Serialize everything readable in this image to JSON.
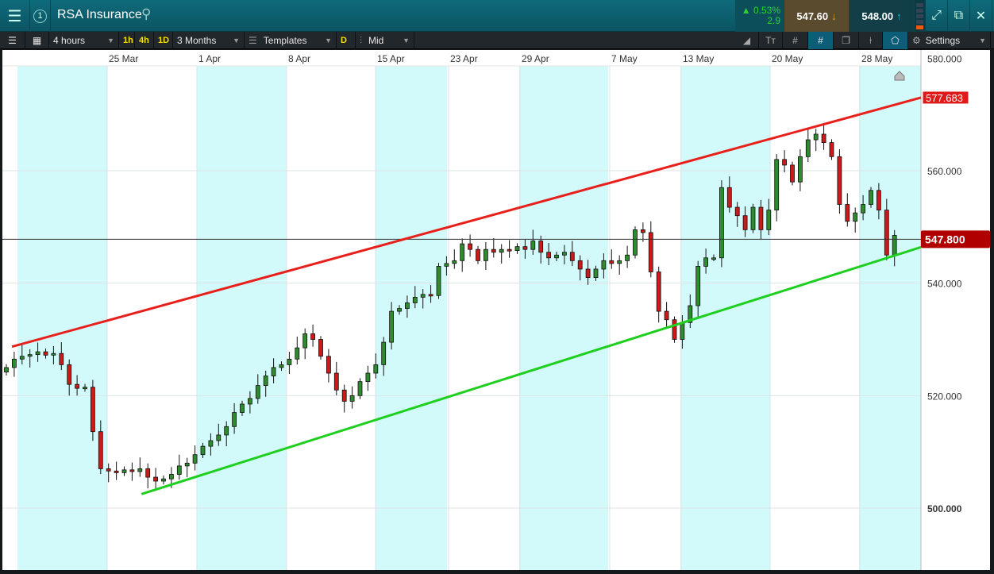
{
  "header": {
    "instrument": "RSA Insurance",
    "badge": "1",
    "change_pct": "0.53%",
    "change_abs": "2.9",
    "sell_price": "547.60",
    "buy_price": "548.00"
  },
  "toolbar": {
    "interval": "4 hours",
    "quick_intervals": [
      "1h",
      "4h",
      "1D"
    ],
    "range": "3 Months",
    "templates": "Templates",
    "d_label": "D",
    "price_type": "Mid",
    "settings": "Settings"
  },
  "colors": {
    "up": "#2e8b2e",
    "down": "#cc1a1a",
    "band": "#d3fafa",
    "resistance": "#e8201c",
    "support": "#1fcf1f",
    "price_tag": "#b00000"
  },
  "chart_data": {
    "type": "candlestick",
    "x_labels": [
      "25 Mar",
      "1 Apr",
      "8 Apr",
      "15 Apr",
      "23 Apr",
      "29 Apr",
      "7 May",
      "13 May",
      "20 May",
      "28 May"
    ],
    "y_ticks": [
      "580.000",
      "560.000",
      "540.000",
      "520.000",
      "500.000"
    ],
    "y_tick_values": [
      580,
      560,
      540,
      520,
      500
    ],
    "ylim": [
      500,
      580
    ],
    "closes": [
      525.0,
      526.5,
      527.0,
      527.3,
      527.8,
      527.2,
      527.5,
      525.5,
      522.0,
      521.3,
      521.5,
      513.6,
      507.0,
      506.6,
      506.3,
      506.8,
      506.5,
      507.0,
      505.5,
      504.8,
      505.2,
      506.0,
      507.5,
      508.0,
      509.5,
      511.0,
      512.0,
      513.0,
      514.5,
      517.0,
      518.5,
      519.5,
      521.8,
      523.5,
      525.0,
      525.5,
      526.5,
      528.5,
      531.0,
      530.0,
      527.0,
      524.0,
      521.0,
      519.0,
      520.0,
      522.5,
      524.0,
      525.5,
      529.5,
      535.0,
      535.5,
      536.5,
      537.5,
      538.0,
      537.8,
      543.0,
      543.5,
      544.0,
      547.0,
      546.0,
      544.0,
      546.0,
      545.5,
      546.0,
      545.8,
      546.5,
      546.0,
      547.5,
      545.5,
      544.5,
      545.0,
      545.5,
      544.0,
      542.5,
      541.0,
      542.5,
      544.0,
      543.5,
      544.0,
      545.0,
      549.5,
      549.0,
      542.0,
      535.0,
      533.5,
      530.0,
      533.0,
      536.0,
      543.0,
      544.5,
      544.5,
      557.0,
      553.5,
      552.0,
      549.5,
      553.5,
      549.5,
      553.0,
      562.0,
      561.0,
      558.0,
      562.5,
      565.5,
      566.5,
      565.0,
      562.5,
      554.0,
      551.0,
      552.5,
      554.0,
      556.5,
      553.0,
      545.0,
      548.5
    ],
    "resistance_line": {
      "start": 528.7,
      "end": 573.0,
      "label": "577.683"
    },
    "support_line": {
      "start_index": 17.2,
      "start": 502.5,
      "end": 546.4
    },
    "current_price": {
      "value": 547.8,
      "label": "547.800"
    }
  }
}
